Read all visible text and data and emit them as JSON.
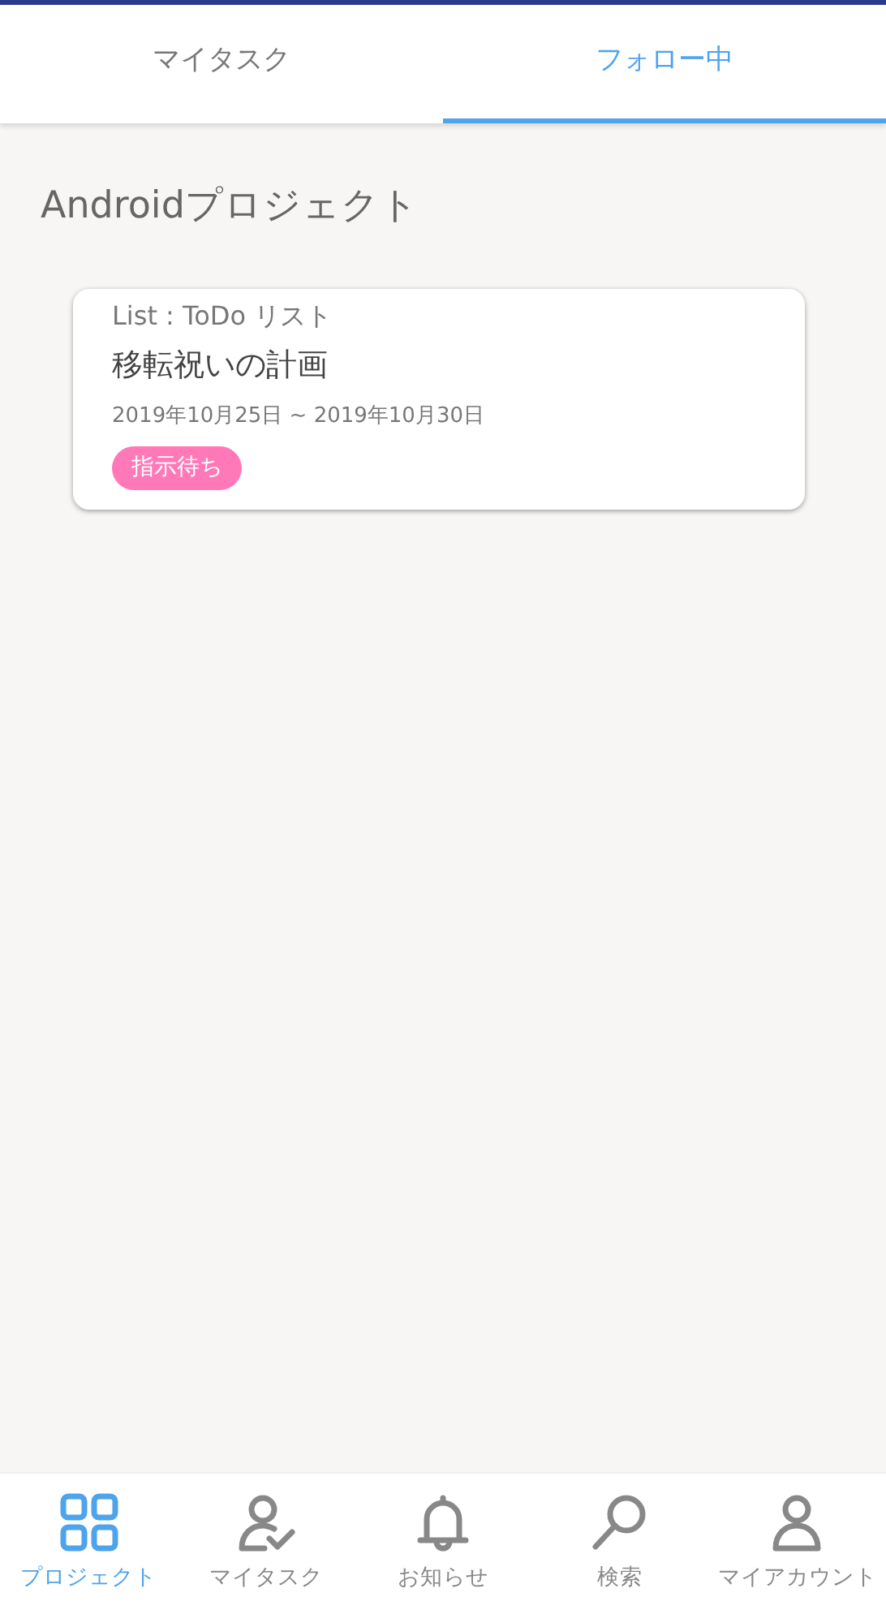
{
  "tabs": [
    {
      "label": "マイタスク",
      "selected": false
    },
    {
      "label": "フォロー中",
      "selected": true
    }
  ],
  "project": {
    "title": "Androidプロジェクト",
    "tasks": [
      {
        "list": "List : ToDo リスト",
        "title": "移転祝いの計画",
        "dates": "2019年10月25日 ~ 2019年10月30日",
        "status": "指示待ち",
        "color": "#ff79b8"
      }
    ]
  },
  "bottom_nav": [
    {
      "label": "プロジェクト",
      "selected": true
    },
    {
      "label": "マイタスク",
      "selected": false
    },
    {
      "label": "お知らせ",
      "selected": false
    },
    {
      "label": "検索",
      "selected": false
    },
    {
      "label": "マイアカウント",
      "selected": false
    }
  ]
}
